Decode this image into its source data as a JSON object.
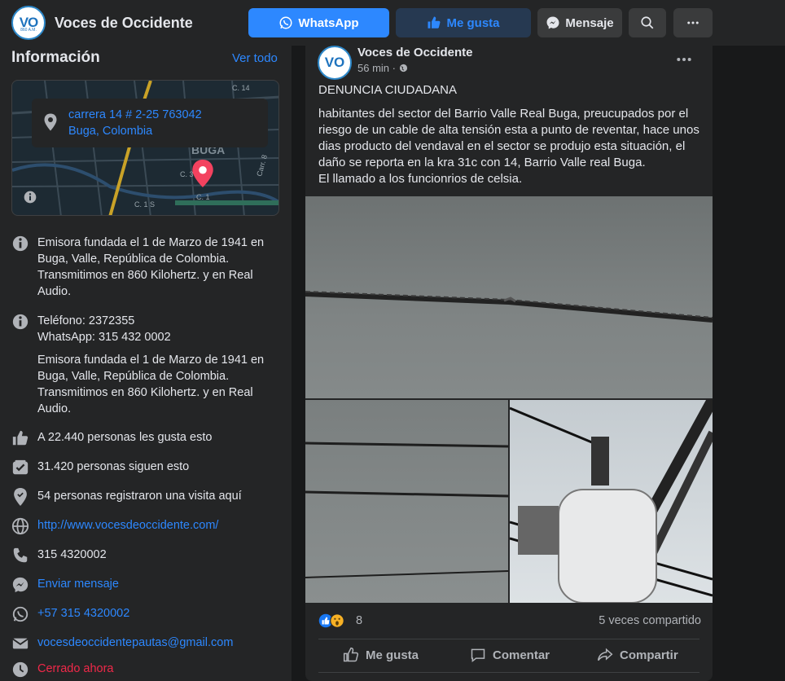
{
  "topbar": {
    "logo_text": "VO",
    "logo_sub": "860 A.M.",
    "page_name": "Voces de Occidente",
    "whatsapp_label": "WhatsApp",
    "like_label": "Me gusta",
    "message_label": "Mensaje"
  },
  "info": {
    "title": "Información",
    "see_all": "Ver todo",
    "map": {
      "address_line1": "carrera 14 # 2-25 763042",
      "address_line2": "Buga, Colombia",
      "labels": [
        "BUGA",
        "C. 14",
        "C. 3",
        "C. 1",
        "C. 1 S",
        "Carr. 8"
      ]
    },
    "about": "Emisora fundada el 1 de Marzo de 1941 en Buga, Valle, República de Colombia. Transmitimos en 860 Kilohertz. y en Real Audio.",
    "phone": "Teléfono: 2372355",
    "whatsapp": "WhatsApp: 315 432 0002",
    "about2": "Emisora fundada el 1 de Marzo de 1941 en Buga, Valle, República de Colombia. Transmitimos en 860 Kilohertz. y en Real Audio.",
    "likes": "A 22.440 personas les gusta esto",
    "followers": "31.420 personas siguen esto",
    "checkins": "54 personas registraron una visita aquí",
    "website": "http://www.vocesdeoccidente.com/",
    "phone2": "315 4320002",
    "send_message": "Enviar mensaje",
    "whatsapp2": "+57 315 4320002",
    "email": "vocesdeoccidentepautas@gmail.com",
    "status": "Cerrado ahora"
  },
  "post": {
    "author": "Voces de Occidente",
    "time": "56 min ·",
    "headline": "DENUNCIA CIUDADANA",
    "body": "habitantes del sector del Barrio Valle Real Buga, preucupados por el riesgo de un cable de alta tensión esta a punto de reventar,  hace unos dias producto del vendaval en el sector se produjo esta situación, el daño se reporta en la kra 31c con 14, Barrio Valle real Buga.",
    "body2": "El llamado a los funcionrios de celsia.",
    "reaction_count": "8",
    "shares": "5 veces compartido",
    "actions": {
      "like": "Me gusta",
      "comment": "Comentar",
      "share": "Compartir"
    }
  },
  "colors": {
    "accent": "#2d88ff",
    "bg": "#18191a",
    "card": "#242526",
    "closed": "#f02849"
  }
}
